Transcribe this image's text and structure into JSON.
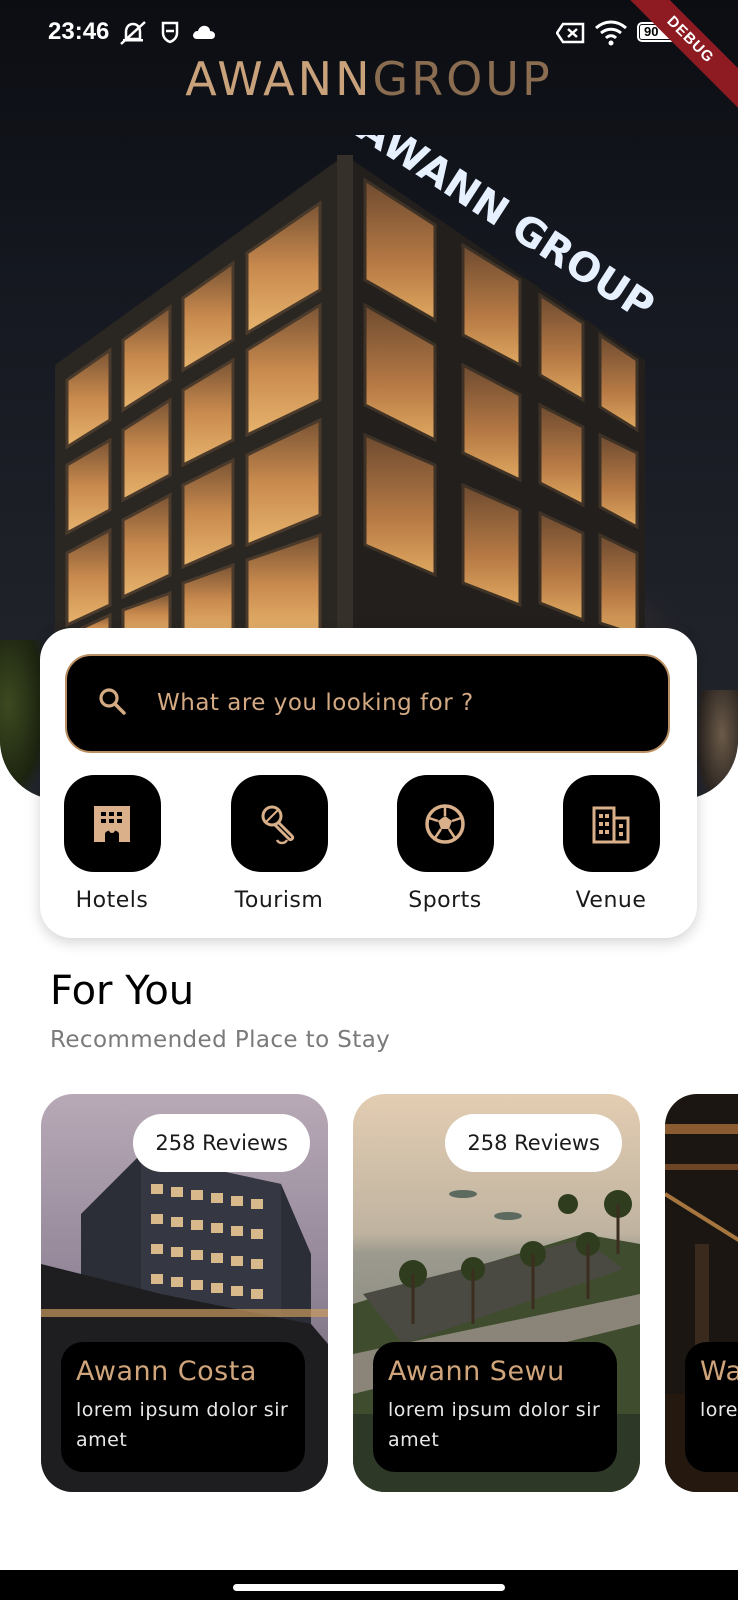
{
  "status_bar": {
    "time": "23:46",
    "battery_level": "90",
    "debug_label": "DEBUG"
  },
  "hero": {
    "brand_part1": "AWANN",
    "brand_part2": "GROUP",
    "sign_text": "AWANN GROUP"
  },
  "search": {
    "placeholder": "What are you looking for ?"
  },
  "categories": [
    {
      "label": "Hotels",
      "icon": "hotel-icon"
    },
    {
      "label": "Tourism",
      "icon": "microphone-icon"
    },
    {
      "label": "Sports",
      "icon": "soccer-ball-icon"
    },
    {
      "label": "Venue",
      "icon": "building-icon"
    }
  ],
  "for_you": {
    "title": "For You",
    "subtitle": "Recommended Place to Stay"
  },
  "places": [
    {
      "name": "Awann Costa",
      "description": "lorem ipsum dolor sir amet",
      "reviews": "258 Reviews"
    },
    {
      "name": "Awann Sewu",
      "description": "lorem ipsum dolor sir amet",
      "reviews": "258 Reviews"
    },
    {
      "name": "Wa",
      "description": "lore sir a",
      "reviews": ""
    }
  ],
  "colors": {
    "accent": "#c9a27b",
    "tile": "#000000",
    "card": "#ffffff"
  }
}
